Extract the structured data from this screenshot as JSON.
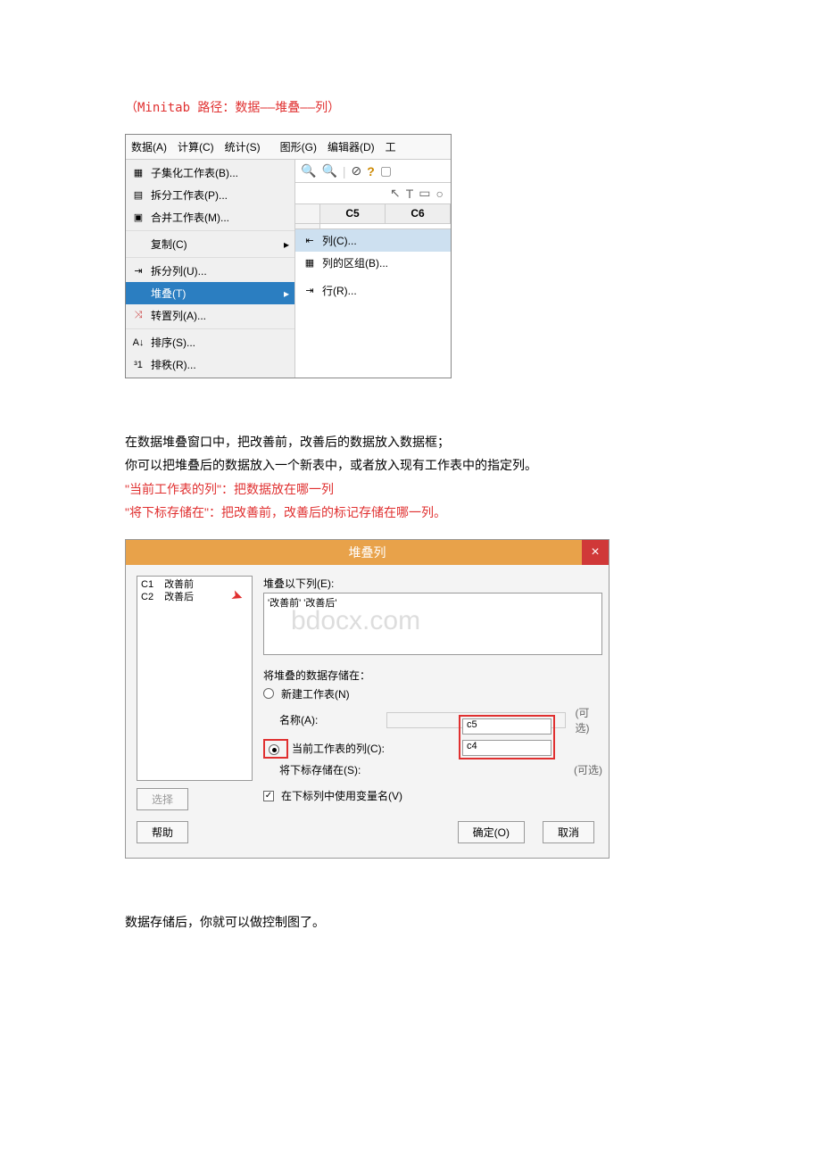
{
  "path_text": "（Minitab 路径：数据——堆叠——列）",
  "menubar": {
    "data": "数据(A)",
    "calc": "计算(C)",
    "stat": "统计(S)",
    "graph": "图形(G)",
    "editor": "编辑器(D)",
    "tools": "工"
  },
  "menu_items": {
    "subset": "子集化工作表(B)...",
    "split": "拆分工作表(P)...",
    "merge": "合并工作表(M)...",
    "copy": "复制(C)",
    "unstack": "拆分列(U)...",
    "stack": "堆叠(T)",
    "transpose": "转置列(A)...",
    "sort": "排序(S)...",
    "rank": "排秩(R)..."
  },
  "submenu": {
    "columns": "列(C)...",
    "blocks": "列的区组(B)...",
    "rows": "行(R)..."
  },
  "col_headers": {
    "c5": "C5",
    "c6": "C6"
  },
  "paragraphs": {
    "p1": "在数据堆叠窗口中，把改善前，改善后的数据放入数据框；",
    "p2": "你可以把堆叠后的数据放入一个新表中，或者放入现有工作表中的指定列。",
    "p3": "\"当前工作表的列\"：把数据放在哪一列",
    "p4": "\"将下标存储在\"：把改善前，改善后的标记存储在哪一列。",
    "p5": "数据存储后，你就可以做控制图了。"
  },
  "dialog": {
    "title": "堆叠列",
    "close": "×",
    "col_list": {
      "c1": "C1",
      "c2": "C2",
      "improve_before": "改善前",
      "improve_after": "改善后"
    },
    "stack_label": "堆叠以下列(E):",
    "stack_value": "'改善前' '改善后'",
    "watermark": "bdocx.com",
    "store_label": "将堆叠的数据存储在：",
    "new_sheet": "新建工作表(N)",
    "name_label": "名称(A):",
    "current_col": "当前工作表的列(C):",
    "current_col_visible": "当前工作表的列(C):",
    "subscript": "将下标存储在(S):",
    "c5_val": "c5",
    "c4_val": "c4",
    "optional": "(可选)",
    "use_varname": "在下标列中使用变量名(V)",
    "select": "选择",
    "help": "帮助",
    "ok": "确定(O)",
    "cancel": "取消"
  }
}
